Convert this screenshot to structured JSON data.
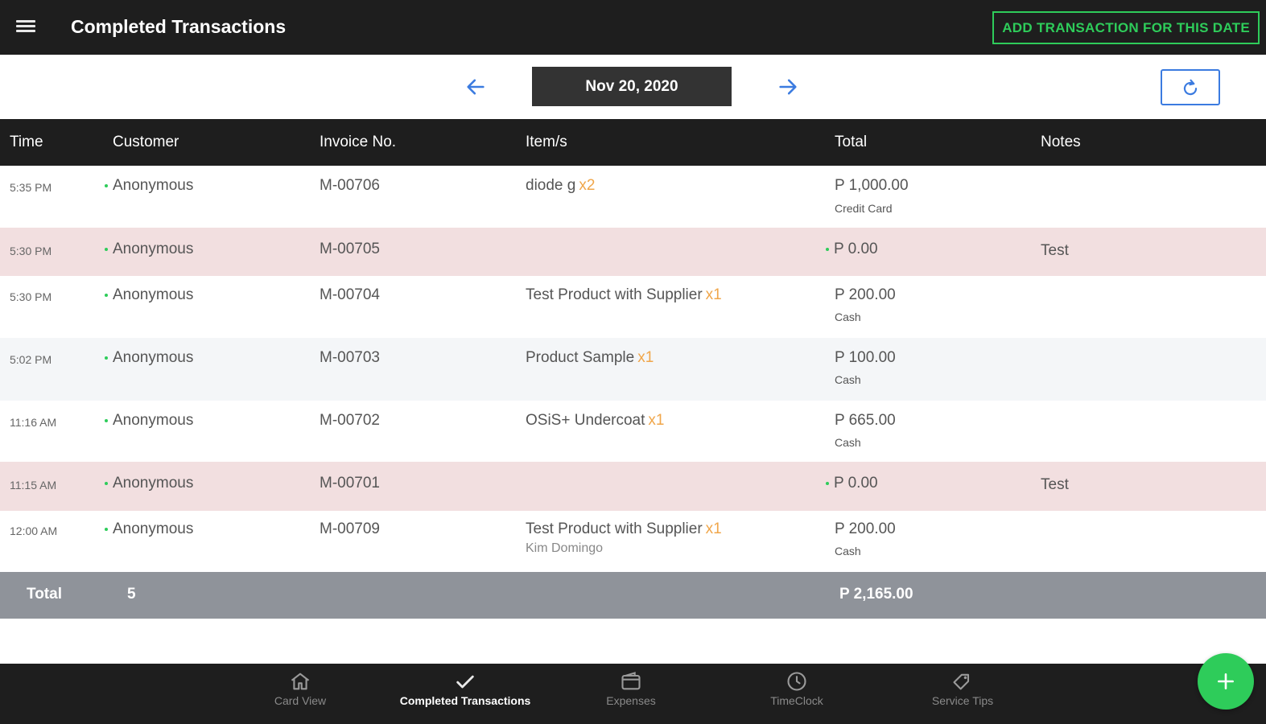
{
  "header": {
    "title": "Completed Transactions",
    "add_button_label": "ADD TRANSACTION FOR THIS DATE"
  },
  "datebar": {
    "date": "Nov 20, 2020"
  },
  "table": {
    "columns": [
      "Time",
      "Customer",
      "Invoice No.",
      "Item/s",
      "Total",
      "Notes"
    ],
    "rows": [
      {
        "time": "5:35 PM",
        "customer": "Anonymous",
        "invoice": "M-00706",
        "item": "diode g",
        "qty": "x2",
        "total": "P 1,000.00",
        "payment": "Credit Card",
        "notes": "",
        "sub": "",
        "highlight": false
      },
      {
        "time": "5:30 PM",
        "customer": "Anonymous",
        "invoice": "M-00705",
        "item": "",
        "qty": "",
        "total": "P 0.00",
        "payment": "",
        "notes": "Test",
        "sub": "",
        "highlight": true
      },
      {
        "time": "5:30 PM",
        "customer": "Anonymous",
        "invoice": "M-00704",
        "item": "Test Product with Supplier",
        "qty": "x1",
        "total": "P 200.00",
        "payment": "Cash",
        "notes": "",
        "sub": "",
        "highlight": false
      },
      {
        "time": "5:02 PM",
        "customer": "Anonymous",
        "invoice": "M-00703",
        "item": "Product Sample",
        "qty": "x1",
        "total": "P 100.00",
        "payment": "Cash",
        "notes": "",
        "sub": "",
        "highlight": false
      },
      {
        "time": "11:16 AM",
        "customer": "Anonymous",
        "invoice": "M-00702",
        "item": "OSiS+ Undercoat",
        "qty": "x1",
        "total": "P 665.00",
        "payment": "Cash",
        "notes": "",
        "sub": "",
        "highlight": false
      },
      {
        "time": "11:15 AM",
        "customer": "Anonymous",
        "invoice": "M-00701",
        "item": "",
        "qty": "",
        "total": "P 0.00",
        "payment": "",
        "notes": "Test",
        "sub": "",
        "highlight": true
      },
      {
        "time": "12:00 AM",
        "customer": "Anonymous",
        "invoice": "M-00709",
        "item": "Test Product with Supplier",
        "qty": "x1",
        "total": "P 200.00",
        "payment": "Cash",
        "notes": "",
        "sub": "Kim Domingo",
        "highlight": false
      }
    ]
  },
  "totals": {
    "label": "Total",
    "count": "5",
    "amount": "P 2,165.00"
  },
  "bottom_nav": [
    {
      "label": "Card View",
      "icon": "home-icon",
      "active": false
    },
    {
      "label": "Completed Transactions",
      "icon": "check-icon",
      "active": true
    },
    {
      "label": "Expenses",
      "icon": "wallet-icon",
      "active": false
    },
    {
      "label": "TimeClock",
      "icon": "clock-icon",
      "active": false
    },
    {
      "label": "Service Tips",
      "icon": "tag-icon",
      "active": false
    }
  ],
  "fab": {
    "icon": "plus-icon"
  },
  "colors": {
    "accent_green": "#2ecc5a",
    "highlight_row": "#f2dfe0",
    "alt_row": "#f4f6f8",
    "topbar": "#1e1e1e",
    "total_bar": "#8f939a",
    "blue": "#3b7be0",
    "qty_orange": "#f0a64a"
  }
}
